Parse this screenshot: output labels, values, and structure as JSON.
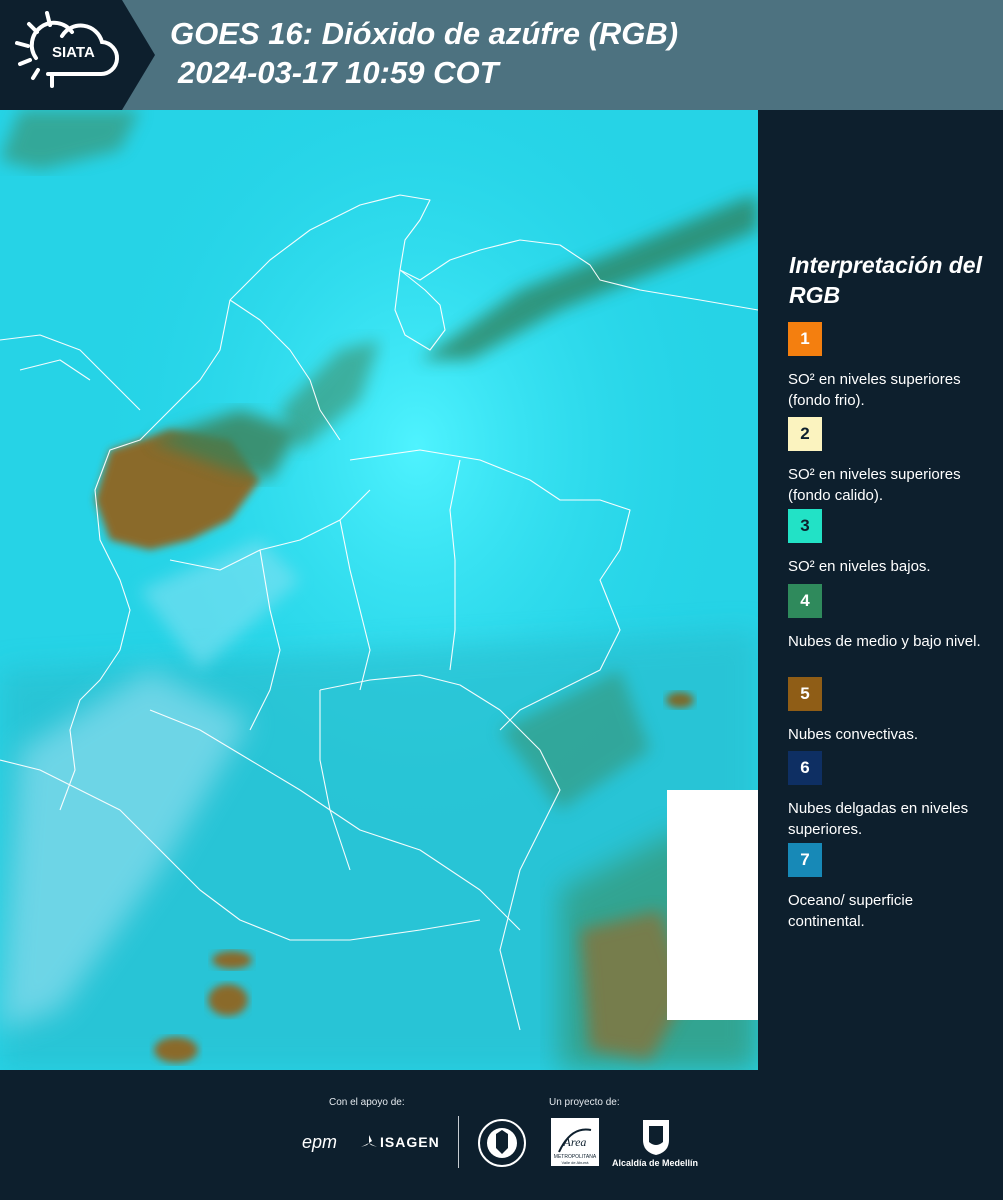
{
  "header": {
    "title_line1": "GOES 16: Dióxido de azúfre (RGB)",
    "title_line2": "2024-03-17 10:59 COT",
    "logo_text": "SIATA"
  },
  "map": {
    "icon": "satellite-map-image",
    "land_colors": {
      "ocean": "#27d6e8",
      "haze": "#86dbef",
      "cloud_green": "#3b8a62",
      "convective": "#8a6a2c"
    }
  },
  "legend": {
    "title": "Interpretación del RGB",
    "items": [
      {
        "num": "1",
        "label": "SO² en niveles superiores (fondo frio).",
        "color": "#f47f0f"
      },
      {
        "num": "2",
        "label": "SO² en niveles superiores (fondo calido).",
        "color": "#fbf3bf"
      },
      {
        "num": "3",
        "label": "SO² en niveles bajos.",
        "color": "#22e2c6"
      },
      {
        "num": "4",
        "label": "Nubes de medio y bajo nivel.",
        "color": "#2f8a5c"
      },
      {
        "num": "5",
        "label": "Nubes convectivas.",
        "color": "#8f5d16"
      },
      {
        "num": "6",
        "label": "Nubes delgadas en niveles superiores.",
        "color": "#0e2f63"
      },
      {
        "num": "7",
        "label": "Oceano/ superficie continental.",
        "color": "#1789b7"
      }
    ]
  },
  "footer": {
    "support_label": "Con el apoyo de:",
    "project_label": "Un proyecto de:",
    "epm": "epm",
    "isagen": "ISAGEN",
    "area_text": "METROPOLITANA",
    "area_sub": "Valle de Aburrá",
    "alcaldia": "Alcaldía de Medellín"
  }
}
